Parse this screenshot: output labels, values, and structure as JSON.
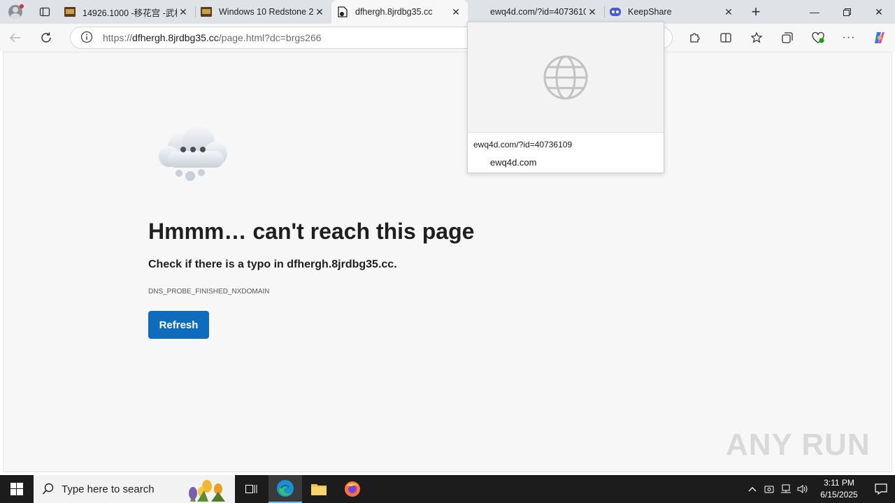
{
  "tabs": [
    {
      "title": "14926.1000 -移花宫 -武林",
      "icon": "game-icon"
    },
    {
      "title": "Windows 10 Redstone 2 |",
      "icon": "game-icon"
    },
    {
      "title": "dfhergh.8jrdbg35.cc",
      "icon": "error-page-icon"
    },
    {
      "title": "ewq4d.com/?id=40736109",
      "icon": "none"
    },
    {
      "title": "KeepShare",
      "icon": "keepshare-icon"
    }
  ],
  "address": {
    "scheme": "https://",
    "host": "dfhergh.8jrdbg35.cc",
    "path": "/page.html?dc=brgs266"
  },
  "error": {
    "heading": "Hmmm… can't reach this page",
    "subtext": "Check if there is a typo in dfhergh.8jrdbg35.cc.",
    "code": "DNS_PROBE_FINISHED_NXDOMAIN",
    "refresh_label": "Refresh"
  },
  "hovercard": {
    "url": "ewq4d.com/?id=40736109",
    "domain": "ewq4d.com"
  },
  "watermark": "ANY RUN",
  "taskbar": {
    "search_placeholder": "Type here to search",
    "time": "3:11 PM",
    "date": "6/15/2025"
  },
  "colors": {
    "accent": "#0f6cbd",
    "tabstrip": "#dfe3e8",
    "page_bg": "#f7f7f7",
    "taskbar": "#1c1c1c"
  }
}
